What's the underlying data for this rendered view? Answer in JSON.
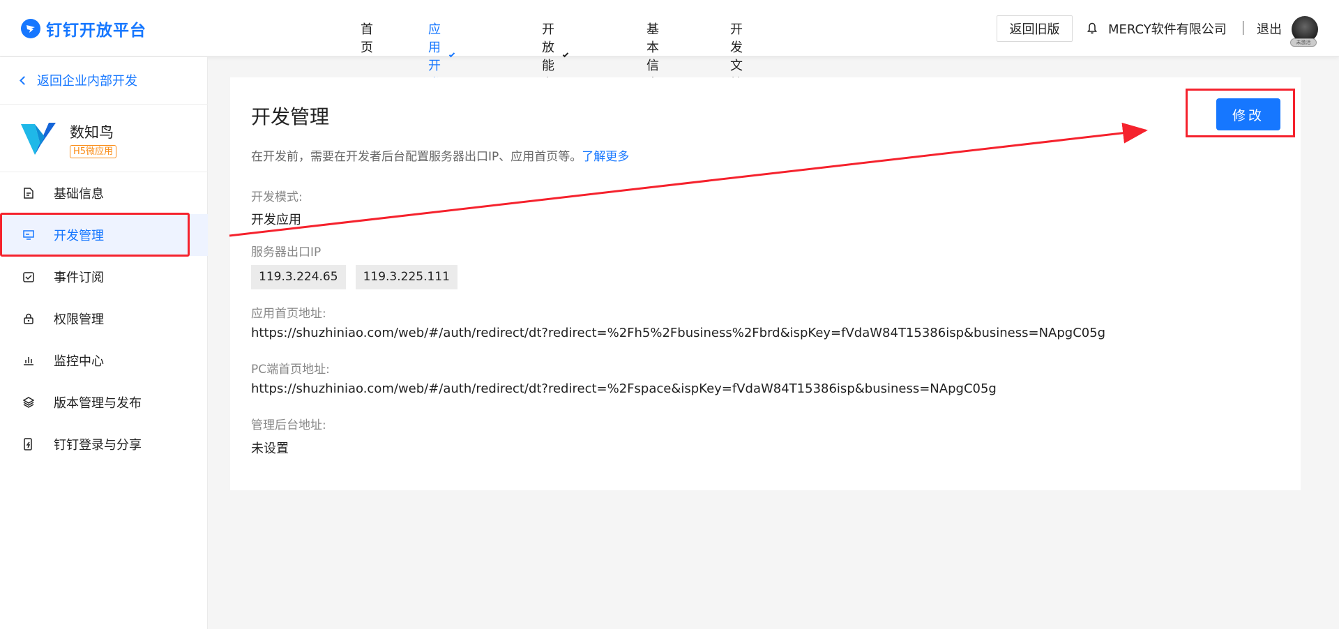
{
  "header": {
    "logo_text": "钉钉开放平台",
    "nav": [
      {
        "label": "首页",
        "active": false,
        "dropdown": false
      },
      {
        "label": "应用开发",
        "active": true,
        "dropdown": true
      },
      {
        "label": "开放能力",
        "active": false,
        "dropdown": true
      },
      {
        "label": "基本信息",
        "active": false,
        "dropdown": false
      },
      {
        "label": "开发文档",
        "active": false,
        "dropdown": false
      }
    ],
    "old_version_label": "返回旧版",
    "company": "MERCY软件有限公司",
    "logout_label": "退出",
    "avatar_tag": "未激活"
  },
  "sidebar": {
    "back_label": "返回企业内部开发",
    "app_name": "数知鸟",
    "app_tag": "H5微应用",
    "menu": [
      {
        "label": "基础信息",
        "icon": "document-icon",
        "active": false
      },
      {
        "label": "开发管理",
        "icon": "monitor-icon",
        "active": true
      },
      {
        "label": "事件订阅",
        "icon": "calendar-check-icon",
        "active": false
      },
      {
        "label": "权限管理",
        "icon": "lock-icon",
        "active": false
      },
      {
        "label": "监控中心",
        "icon": "bar-chart-icon",
        "active": false
      },
      {
        "label": "版本管理与发布",
        "icon": "layers-icon",
        "active": false
      },
      {
        "label": "钉钉登录与分享",
        "icon": "phone-login-icon",
        "active": false
      }
    ]
  },
  "main": {
    "title": "开发管理",
    "edit_label": "修改",
    "description": "在开发前，需要在开发者后台配置服务器出口IP、应用首页等。",
    "learn_more": "了解更多",
    "dev_mode_label": "开发模式:",
    "dev_mode_value": "开发应用",
    "server_ip_label": "服务器出口IP",
    "server_ips": [
      "119.3.224.65",
      "119.3.225.111"
    ],
    "homepage_label": "应用首页地址:",
    "homepage_value": "https://shuzhiniao.com/web/#/auth/redirect/dt?redirect=%2Fh5%2Fbusiness%2Fbrd&ispKey=fVdaW84T15386isp&business=NApgC05g",
    "pc_homepage_label": "PC端首页地址:",
    "pc_homepage_value": "https://shuzhiniao.com/web/#/auth/redirect/dt?redirect=%2Fspace&ispKey=fVdaW84T15386isp&business=NApgC05g",
    "admin_label": "管理后台地址:",
    "admin_value": "未设置"
  },
  "colors": {
    "accent": "#1677ff",
    "annotation_red": "#f5222d",
    "tag_orange": "#fa8c16"
  }
}
